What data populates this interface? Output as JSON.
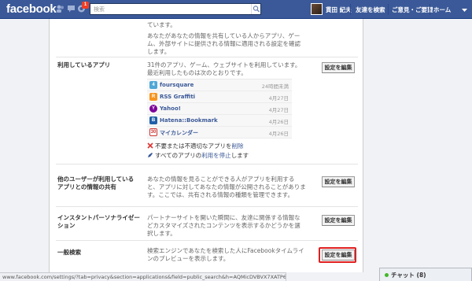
{
  "topbar": {
    "logo": "facebook",
    "notification_count": "1",
    "search_placeholder": "検索",
    "user_name": "貫田 紀夫",
    "nav_find_friends": "友達を検索",
    "nav_feedback": "ご意見・ご要望",
    "nav_home": "ホーム",
    "brand_color": "#3b5998"
  },
  "intro": {
    "text1": "ています。",
    "text2": "あなたがあなたの情報を共有している人からアプリ、ゲーム、外部サイトに提供される情報に適用される設定を確認します。"
  },
  "sections": {
    "apps_in_use": {
      "label": "利用しているアプリ",
      "description": "31件のアプリ、ゲーム、ウェブサイトを利用しています。最近利用したものは次のとおりです。",
      "edit_label": "設定を編集",
      "apps": [
        {
          "name": "foursquare",
          "date": "24時間未満",
          "icon": "foursquare-icon",
          "color": "#4fa7d6"
        },
        {
          "name": "RSS Graffiti",
          "date": "4月27日",
          "icon": "rss-icon",
          "color": "#f7941d"
        },
        {
          "name": "Yahoo!",
          "date": "4月27日",
          "icon": "yahoo-icon",
          "color": "#7b0099"
        },
        {
          "name": "Hatena::Bookmark",
          "date": "4月26日",
          "icon": "hatena-icon",
          "color": "#1f5fa8"
        },
        {
          "name": "マイカレンダー",
          "date": "4月26日",
          "icon": "calendar-icon",
          "color": "#ffffff"
        }
      ],
      "remove_prefix": "不要または不適切なアプリを",
      "remove_link": "削除",
      "disable_prefix": "すべてのアプリの",
      "disable_link": "利用を停止",
      "disable_suffix": "します"
    },
    "info_shared": {
      "label": "他のユーザーが利用しているアプリとの情報の共有",
      "description": "あなたの情報を見ることができる人がアプリを利用すると、アプリに対してあなたの情報が公開されることがあります。ここでは、共有される情報の種類を管理できます。",
      "edit_label": "設定を編集"
    },
    "instant_personalization": {
      "label": "インスタントパーソナライゼーション",
      "description": "パートナーサイトを開いた瞬間に、友達に関係する情報などカスタマイズされたコンテンツを表示するかどうかを選択します。",
      "edit_label": "設定を編集"
    },
    "public_search": {
      "label": "一般検索",
      "description": "検索エンジンであなたを検索した人にFacebookタイムラインのプレビューを表示します。",
      "edit_label": "設定を編集",
      "highlight_color": "#e01f1f"
    }
  },
  "statusbar": {
    "url": "www.facebook.com/settings/?tab=privacy&section=applications&field=public_search&h=AQMicDVBVX7XATP6"
  },
  "chat": {
    "label": "チャット (8)"
  }
}
